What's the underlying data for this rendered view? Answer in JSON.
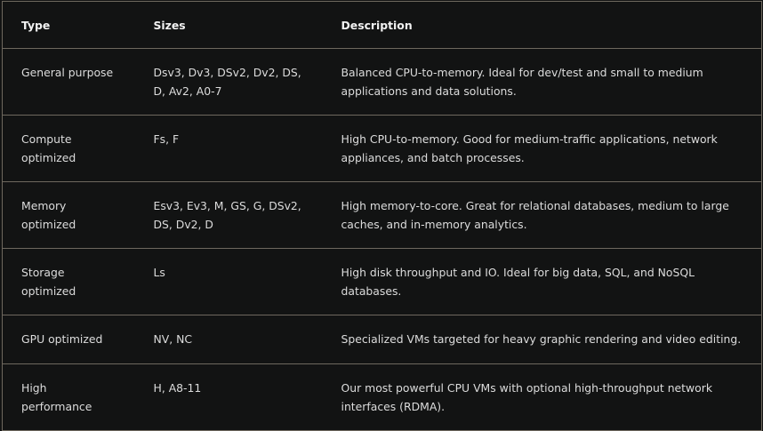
{
  "table": {
    "headers": [
      "Type",
      "Sizes",
      "Description"
    ],
    "rows": [
      {
        "type": "General purpose",
        "sizes": "Dsv3, Dv3, DSv2, Dv2, DS, D, Av2, A0-7",
        "description": "Balanced CPU-to-memory. Ideal for dev/test and small to medium applications and data solutions."
      },
      {
        "type": "Compute optimized",
        "sizes": "Fs, F",
        "description": "High CPU-to-memory. Good for medium-traffic applications, network appliances, and batch processes."
      },
      {
        "type": "Memory optimized",
        "sizes": "Esv3, Ev3, M, GS, G, DSv2, DS, Dv2, D",
        "description": "High memory-to-core. Great for relational databases, medium to large caches, and in-memory analytics."
      },
      {
        "type": "Storage optimized",
        "sizes": "Ls",
        "description": "High disk throughput and IO. Ideal for big data, SQL, and NoSQL databases."
      },
      {
        "type": "GPU optimized",
        "sizes": "NV, NC",
        "description": "Specialized VMs targeted for heavy graphic rendering and video editing."
      },
      {
        "type": "High performance",
        "sizes": "H, A8-11",
        "description": "Our most powerful CPU VMs with optional high-throughput network interfaces (RDMA)."
      }
    ]
  }
}
